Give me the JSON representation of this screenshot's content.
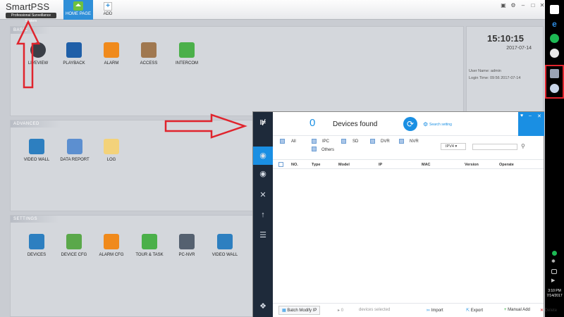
{
  "smartpss": {
    "brand": "SmartPSS",
    "tagline": "Professional Surveillance System",
    "tabs": {
      "home": "HOME PAGE",
      "add": "ADD"
    },
    "sections": {
      "basic": {
        "title": "BASIC",
        "apps": [
          "LIVEVIEW",
          "PLAYBACK",
          "ALARM",
          "ACCESS",
          "INTERCOM"
        ]
      },
      "advanced": {
        "title": "ADVANCED",
        "apps": [
          "VIDEO WALL",
          "DATA REPORT",
          "LOG"
        ]
      },
      "settings": {
        "title": "SETTINGS",
        "apps": [
          "DEVICES",
          "DEVICE CFG",
          "ALARM CFG",
          "TOUR & TASK",
          "PC-NVR",
          "VIDEO WALL"
        ]
      }
    },
    "clock": {
      "time": "15:10:15",
      "date": "2017-07-14"
    },
    "user": {
      "name_line": "User Name: admin",
      "login_line": "Login Time: 09:56 2017-07-14"
    }
  },
  "config_tool": {
    "count": "0",
    "found_label": "Devices found",
    "search_setting": "Search setting",
    "filters": [
      "All",
      "IPC",
      "SD",
      "DVR",
      "NVR",
      "Others"
    ],
    "ip_version": "IPV4",
    "columns": [
      "NO.",
      "Type",
      "Model",
      "IP",
      "MAC",
      "Version",
      "Operate"
    ],
    "bottom": {
      "batch": "Batch Modify IP",
      "selected_count": "0",
      "selected_label": "devices selected",
      "import": "Import",
      "export": "Export",
      "manual_add": "Manual Add",
      "delete": "Delete"
    }
  },
  "taskbar": {
    "time": "3:10 PM",
    "date": "7/14/2017"
  },
  "colors": {
    "accent": "#1a8fe3",
    "arrow": "#e0242d",
    "sidebar": "#1e2a3a"
  }
}
